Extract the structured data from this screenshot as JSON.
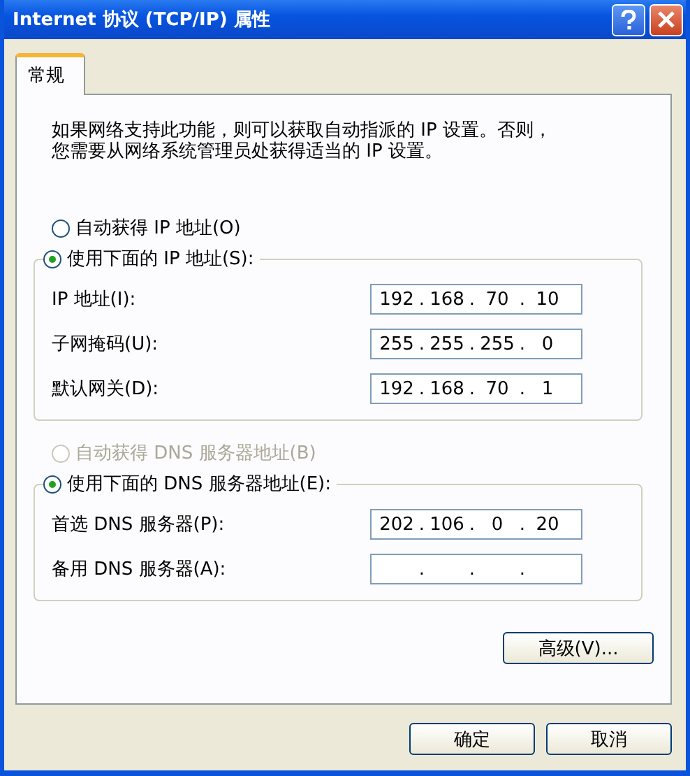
{
  "window": {
    "title": "Internet 协议 (TCP/IP) 属性"
  },
  "tabs": [
    {
      "label": "常规",
      "selected": true
    }
  ],
  "description": [
    "如果网络支持此功能，则可以获取自动指派的 IP 设置。否则，",
    "您需要从网络系统管理员处获得适当的 IP 设置。"
  ],
  "ip_separator": ".",
  "sections": [
    {
      "auto_option": {
        "label": "自动获得 IP 地址(O)",
        "selected": false,
        "disabled": false
      },
      "manual_option": {
        "label": "使用下面的 IP 地址(S):",
        "selected": true,
        "disabled": false
      },
      "fields": [
        {
          "label": "IP 地址(I):",
          "octets": [
            "192",
            "168",
            "70",
            "10"
          ]
        },
        {
          "label": "子网掩码(U):",
          "octets": [
            "255",
            "255",
            "255",
            "0"
          ]
        },
        {
          "label": "默认网关(D):",
          "octets": [
            "192",
            "168",
            "70",
            "1"
          ]
        }
      ]
    },
    {
      "auto_option": {
        "label": "自动获得 DNS 服务器地址(B)",
        "selected": false,
        "disabled": true
      },
      "manual_option": {
        "label": "使用下面的 DNS 服务器地址(E):",
        "selected": true,
        "disabled": false
      },
      "fields": [
        {
          "label": "首选 DNS 服务器(P):",
          "octets": [
            "202",
            "106",
            "0",
            "20"
          ]
        },
        {
          "label": "备用 DNS 服务器(A):"
        }
      ]
    }
  ],
  "advanced_button": "高级(V)...",
  "buttons": [
    "确定",
    "取消"
  ]
}
